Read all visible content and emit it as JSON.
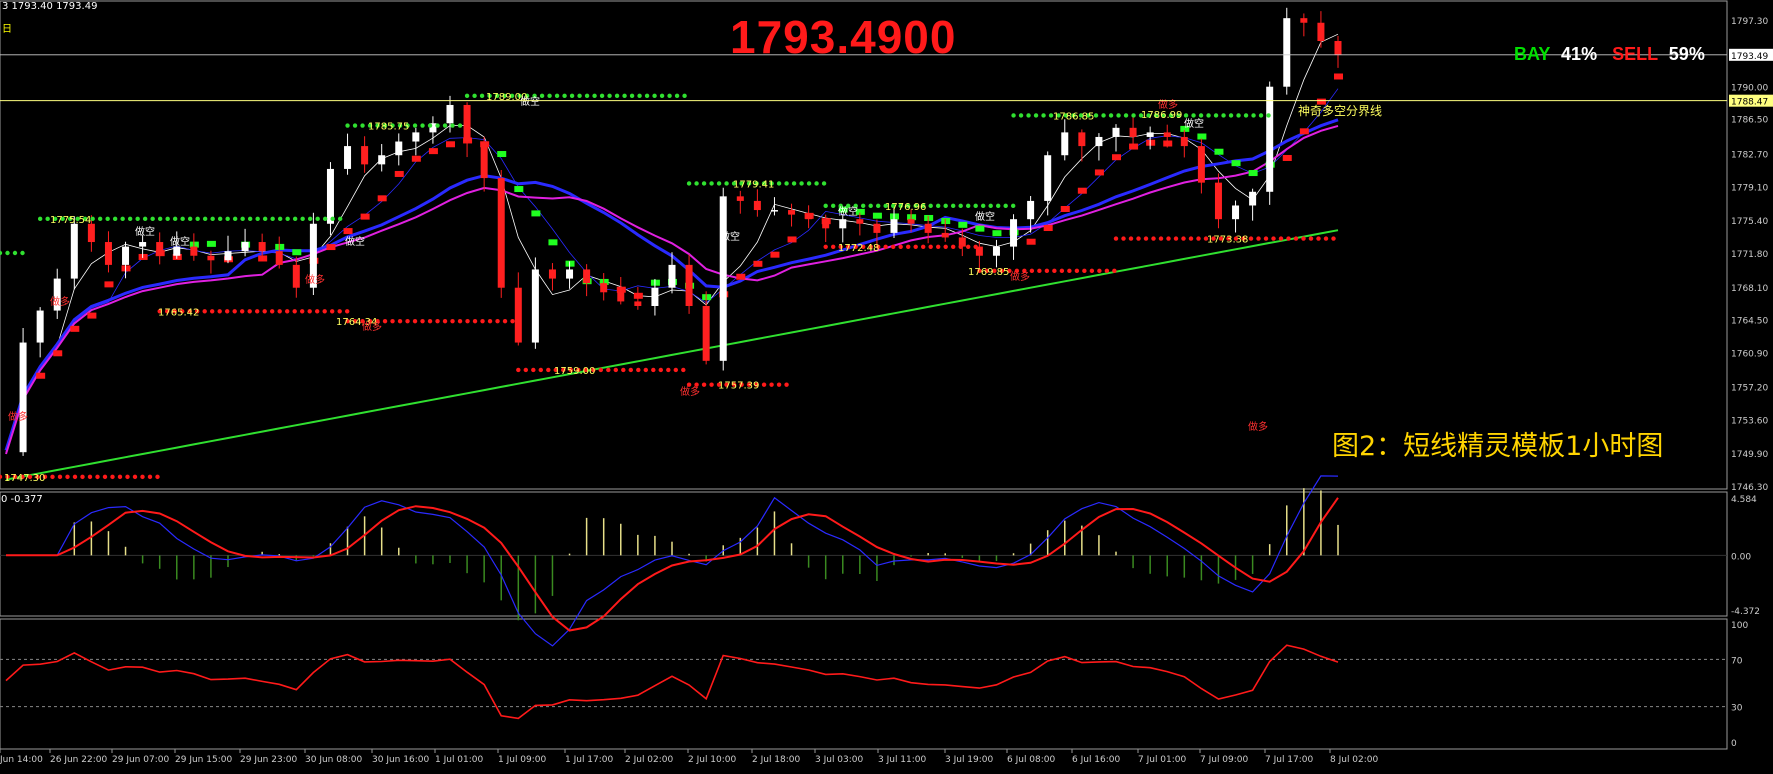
{
  "header": {
    "quote_text": "3 1793.40 1793.49",
    "timeframe_glyph": "日"
  },
  "big_price": "1793.4900",
  "sentiment": {
    "buy_label": "BAY",
    "buy_pct": "41%",
    "sell_label": "SELL",
    "sell_pct": "59%",
    "buy_color": "#00e000",
    "sell_color": "#ff1a1a"
  },
  "caption": "图2：短线精灵模板1小时图",
  "boundary_label": "神奇多空分界线",
  "macd_header": "0 -0.377",
  "colors": {
    "bull_candle": "#ffffff",
    "bear_candle": "#ff2020",
    "ma_blue": "#2a2aff",
    "ma_magenta": "#e020e0",
    "ma_green": "#30e030",
    "resistance_dots": "#30e030",
    "support_dots": "#ff1a1a",
    "price_line": "#ffffff",
    "boundary_line": "#ffff80",
    "macd_line": "#ff1a1a",
    "signal_line": "#2a2aff",
    "rsi_line": "#ff1a1a",
    "level_text": "#ffff60"
  },
  "chart_data": [
    {
      "type": "candlestick",
      "panel": "price",
      "y_axis_ticks": [
        1797.3,
        1793.49,
        1790.0,
        1788.47,
        1786.5,
        1782.7,
        1779.1,
        1775.4,
        1771.8,
        1768.1,
        1764.5,
        1760.9,
        1757.2,
        1753.6,
        1749.9,
        1746.3
      ],
      "current_price": 1793.49,
      "boundary_price": 1788.47,
      "ylim": [
        1746.3,
        1800.2
      ],
      "x_labels": [
        "Jun 14:00",
        "26 Jun 22:00",
        "29 Jun 07:00",
        "29 Jun 15:00",
        "29 Jun 23:00",
        "30 Jun 08:00",
        "30 Jun 16:00",
        "1 Jul 01:00",
        "1 Jul 09:00",
        "1 Jul 17:00",
        "2 Jul 02:00",
        "2 Jul 10:00",
        "2 Jul 18:00",
        "3 Jul 03:00",
        "3 Jul 11:00",
        "3 Jul 19:00",
        "6 Jul 08:00",
        "6 Jul 16:00",
        "7 Jul 01:00",
        "7 Jul 09:00",
        "7 Jul 17:00",
        "8 Jul 02:00"
      ],
      "close_path": [
        1750.0,
        1762.0,
        1765.5,
        1769.0,
        1775.0,
        1773.0,
        1770.5,
        1772.5,
        1773.0,
        1771.5,
        1772.5,
        1771.5,
        1771.0,
        1772.0,
        1773.0,
        1772.0,
        1770.5,
        1768.0,
        1775.0,
        1781.0,
        1783.5,
        1781.5,
        1782.5,
        1784.0,
        1785.0,
        1786.0,
        1788.0,
        1784.0,
        1780.0,
        1768.0,
        1762.0,
        1770.0,
        1769.0,
        1770.0,
        1768.5,
        1767.5,
        1766.5,
        1766.0,
        1768.0,
        1770.5,
        1766.0,
        1760.0,
        1778.0,
        1777.5,
        1776.5,
        1776.5,
        1776.0,
        1775.5,
        1774.5,
        1775.5,
        1775.0,
        1774.0,
        1775.5,
        1775.0,
        1774.0,
        1773.5,
        1772.5,
        1771.5,
        1772.5,
        1775.5,
        1777.5,
        1782.5,
        1785.0,
        1783.5,
        1784.5,
        1785.5,
        1784.5,
        1785.0,
        1784.5,
        1783.5,
        1779.5,
        1775.5,
        1777.0,
        1778.5,
        1790.0,
        1797.5,
        1797.0,
        1795.0,
        1793.5
      ],
      "level_labels": [
        {
          "text": "1747.30",
          "price": 1747.3
        },
        {
          "text": "1775.54",
          "price": 1775.54
        },
        {
          "text": "1765.42",
          "price": 1765.42
        },
        {
          "text": "1764.34",
          "price": 1764.34
        },
        {
          "text": "1785.75",
          "price": 1785.75
        },
        {
          "text": "1789.00",
          "price": 1789.0
        },
        {
          "text": "1759.00",
          "price": 1759.0
        },
        {
          "text": "1779.41",
          "price": 1779.41
        },
        {
          "text": "1757.39",
          "price": 1757.39
        },
        {
          "text": "1776.96",
          "price": 1776.96
        },
        {
          "text": "1772.48",
          "price": 1772.48
        },
        {
          "text": "1769.85",
          "price": 1769.85
        },
        {
          "text": "1786.85",
          "price": 1786.85
        },
        {
          "text": "1786.99",
          "price": 1786.99
        },
        {
          "text": "1773.38",
          "price": 1773.38
        }
      ],
      "signal_labels": {
        "long": "做多",
        "short": "做空"
      }
    },
    {
      "type": "macd",
      "panel": "macd",
      "y_axis_ticks": [
        4.584,
        0.0,
        -4.372
      ],
      "ylim": [
        -4.372,
        4.584
      ]
    },
    {
      "type": "line",
      "panel": "rsi",
      "y_axis_ticks": [
        100,
        70,
        30,
        0
      ],
      "ylim": [
        0,
        100
      ],
      "levels": [
        70,
        30
      ]
    }
  ]
}
